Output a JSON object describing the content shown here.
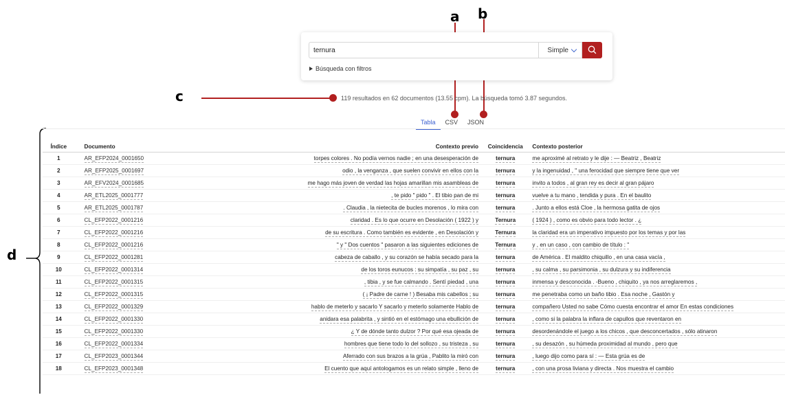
{
  "annotations": {
    "a": "a",
    "b": "b",
    "c": "c",
    "d": "d"
  },
  "search": {
    "query": "ternura",
    "mode": "Simple",
    "filters_label": "Búsqueda con filtros"
  },
  "summary": "119 resultados en 62 documentos (13.55 cpm). La búsqueda tomó 3.87 segundos.",
  "tabs": [
    "Tabla",
    "CSV",
    "JSON"
  ],
  "table": {
    "headers": [
      "Índice",
      "Documento",
      "Contexto previo",
      "Coincidencia",
      "Contexto posterior"
    ],
    "rows": [
      {
        "idx": "1",
        "doc": "AR_EFP2024_0001650",
        "pre": "torpes colores . No podía vernos nadie ; en una desesperación de",
        "match": "ternura",
        "post": "me aproximé al retrato y le dije : — Beatriz , Beatriz"
      },
      {
        "idx": "2",
        "doc": "AR_EFP2025_0001697",
        "pre": "odio , la venganza , que suelen convivir en ellos con la",
        "match": "ternura",
        "post": "y la ingenuidad , \" una ferocidad que siempre tiene que ver"
      },
      {
        "idx": "3",
        "doc": "AR_EFV2024_0001685",
        "pre": "me hago más joven de verdad las hojas amarillan mis asambleas de",
        "match": "ternura",
        "post": "invito a todos , al gran rey es decir al gran pájaro"
      },
      {
        "idx": "4",
        "doc": "AR_ETL2025_0001777",
        "pre": ", te pido \" pido \" . El tibio pan de mi",
        "match": "ternura",
        "post": "vuelve a tu mano , tendida y pura . En el baulito"
      },
      {
        "idx": "5",
        "doc": "AR_ETL2025_0001787",
        "pre": ". Claudia , la nietecita de bucles morenos , lo mira con",
        "match": "ternura",
        "post": ". Junto a ellos está Cloe , la hermosa gatita de ojos"
      },
      {
        "idx": "6",
        "doc": "CL_EFP2022_0001216",
        "pre": "claridad . Es lo que ocurre en Desolación ( 1922 ) y",
        "match": "Ternura",
        "post": "( 1924 ) , como es obvio para todo lector . ¿"
      },
      {
        "idx": "7",
        "doc": "CL_EFP2022_0001216",
        "pre": "de su escritura . Como también es evidente , en Desolación y",
        "match": "Ternura",
        "post": "la claridad era un imperativo impuesto por los temas y por las"
      },
      {
        "idx": "8",
        "doc": "CL_EFP2022_0001216",
        "pre": "\" y \" Dos cuentos \" pasaron a las siguientes ediciones de",
        "match": "Ternura",
        "post": "y , en un caso , con cambio de título : \""
      },
      {
        "idx": "9",
        "doc": "CL_EFP2022_0001281",
        "pre": "cabeza de caballo , y su corazón se había secado para la",
        "match": "ternura",
        "post": "de América . El maldito chiquillo , en una casa vacía ,"
      },
      {
        "idx": "10",
        "doc": "CL_EFP2022_0001314",
        "pre": "de los toros eunucos : su simpatía , su paz , su",
        "match": "ternura",
        "post": ", su calma , su parsimonia , su dulzura y su indiferencia"
      },
      {
        "idx": "11",
        "doc": "CL_EFP2022_0001315",
        "pre": ", tibia , y se fue calmando . Sentí piedad , una",
        "match": "ternura",
        "post": "inmensa y desconocida . -Bueno , chiquito , ya nos arreglaremos ,"
      },
      {
        "idx": "12",
        "doc": "CL_EFP2022_0001315",
        "pre": "( ¡ Padre de carne ! ) Besaba mis cabellos ; su",
        "match": "ternura",
        "post": "me penetraba como un baño tibio . Esa noche , Gastón y"
      },
      {
        "idx": "13",
        "doc": "CL_EFP2022_0001329",
        "pre": "hablo de meterlo y sacarlo Y sacarlo y meterlo solamente Hablo de",
        "match": "ternura",
        "post": "compañero Usted no sabe Cómo cuesta encontrar el amor En estas condiciones"
      },
      {
        "idx": "14",
        "doc": "CL_EFP2022_0001330",
        "pre": "anidara esa palabrita , y sintió en el estómago una ebullición de",
        "match": "ternura",
        "post": ", como si la palabra la inflara de capullos que reventaron en"
      },
      {
        "idx": "15",
        "doc": "CL_EFP2022_0001330",
        "pre": "¿ Y de dónde tanto dulzor ? Por qué esa ojeada de",
        "match": "ternura",
        "post": "desordenándole el juego a los chicos , que desconcertados , sólo atinaron"
      },
      {
        "idx": "16",
        "doc": "CL_EFP2022_0001334",
        "pre": "hombres que tiene todo lo del sollozo , su tristeza , su",
        "match": "ternura",
        "post": ", su desazón , su húmeda proximidad al mundo , pero que"
      },
      {
        "idx": "17",
        "doc": "CL_EFP2023_0001344",
        "pre": "Aferrado con sus brazos a la grúa , Pablito la miró con",
        "match": "ternura",
        "post": ", luego dijo como para sí : — Esta grúa es de"
      },
      {
        "idx": "18",
        "doc": "CL_EFP2023_0001348",
        "pre": "El cuento que aquí antologamos es un relato simple , lleno de",
        "match": "ternura",
        "post": ", con una prosa liviana y directa . Nos muestra el cambio"
      }
    ]
  },
  "colors": {
    "accent": "#b11f1f",
    "tab_active": "#3a5fd0"
  },
  "icons": {
    "search_button": "search-icon",
    "mode_dropdown": "chevron-down-icon",
    "filters": "caret-right-icon"
  }
}
